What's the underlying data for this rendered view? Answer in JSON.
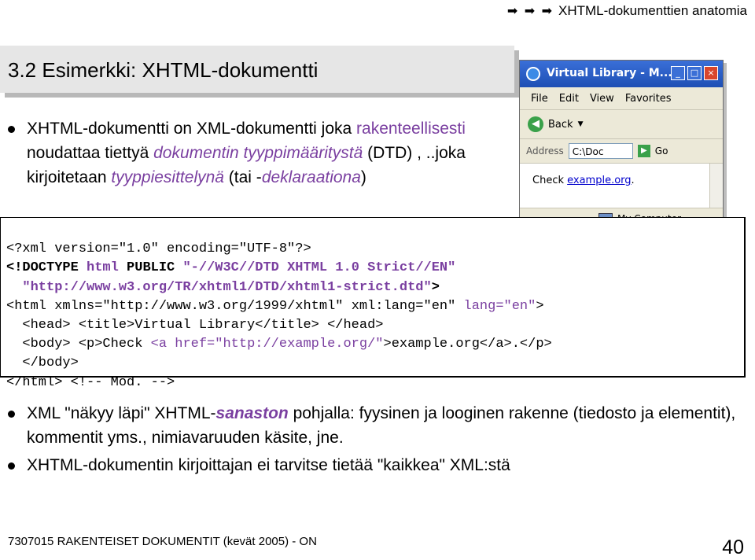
{
  "header": {
    "arrows": "➡ ➡ ➡",
    "title": "XHTML-dokumenttien anatomia"
  },
  "slide_title": "3.2 Esimerkki: XHTML-dokumentti",
  "bullet1": {
    "p1": "XHTML-dokumentti on XML-dokumentti joka ",
    "k1": "rakenteellisesti",
    "p2": " noudattaa tiettyä ",
    "k2": "dokumentin tyyppimääritystä",
    "p3": " (DTD) , ..joka kirjoitetaan ",
    "k3": "tyyppiesittelynä",
    "p4": " (tai -",
    "k4": "deklaraationa",
    "p5": ")"
  },
  "browser": {
    "title": "Virtual Library - M...",
    "menu": [
      "File",
      "Edit",
      "View",
      "Favorites"
    ],
    "back_label": "Back",
    "address_label": "Address",
    "address_value": "C:\\Doc",
    "go_label": "Go",
    "content_text": "Check ",
    "content_link": "example.org",
    "content_end": ".",
    "status_text": "My Computer"
  },
  "code": {
    "l1": "<?xml version=\"1.0\" encoding=\"UTF-8\"?>",
    "l2a": "<!DOCTYPE ",
    "l2b": "html",
    "l2c": " PUBLIC ",
    "l2d": "\"-//W3C//DTD XHTML 1.0 Strict//EN\"",
    "l3": "  \"http://www.w3.org/TR/xhtml1/DTD/xhtml1-strict.dtd\"",
    "l3end": ">",
    "l4a": "<html ",
    "l4b": "xmlns=\"http://www.w3.org/1999/xhtml\" ",
    "l4c": "xml:lang=\"en\" ",
    "l4d": "lang=\"en\"",
    "l4e": ">",
    "l5a": "  <head> <title>",
    "l5b": "Virtual Library",
    "l5c": "</title> </head>",
    "l6a": "  <body> <p>",
    "l6b": "Check ",
    "l6c": "<a ",
    "l6d": "href=\"http://example.org/\"",
    "l6e": ">example.org</a>.</p>",
    "l7": "  </body>",
    "l8a": "</html> ",
    "l8b": "<!-- Mod. -->"
  },
  "bullet2": {
    "p1": "XML \"näkyy läpi\" XHTML-",
    "k1": "sanaston",
    "p2": " pohjalla: fyysinen ja looginen rakenne (tiedosto ja elementit), kommentit yms., nimiavaruuden käsite, jne."
  },
  "bullet3": {
    "text": "XHTML-dokumentin kirjoittajan ei tarvitse tietää \"kaikkea\" XML:stä"
  },
  "footer": {
    "course": "7307015 RAKENTEISET DOKUMENTIT (kevät 2005) - ON",
    "page": "40"
  }
}
